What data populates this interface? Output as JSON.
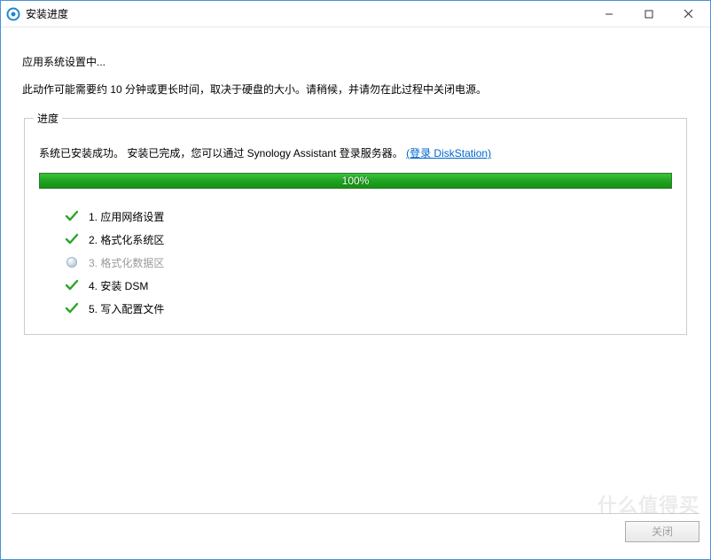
{
  "window": {
    "title": "安装进度"
  },
  "heading": "应用系统设置中...",
  "subtext": "此动作可能需要约 10 分钟或更长时间，取决于硬盘的大小。请稍候，并请勿在此过程中关闭电源。",
  "progress": {
    "legend": "进度",
    "status_prefix": "系统已安装成功。 安装已完成，您可以通过 Synology Assistant 登录服务器。",
    "link_text": "(登录 DiskStation)",
    "percent_label": "100%",
    "percent_value": 100
  },
  "steps": [
    {
      "state": "done",
      "label": "1. 应用网络设置"
    },
    {
      "state": "done",
      "label": "2. 格式化系统区"
    },
    {
      "state": "skipped",
      "label": "3. 格式化数据区"
    },
    {
      "state": "done",
      "label": "4. 安装 DSM"
    },
    {
      "state": "done",
      "label": "5. 写入配置文件"
    }
  ],
  "footer": {
    "close_label": "关闭"
  },
  "watermark": "什么值得买"
}
